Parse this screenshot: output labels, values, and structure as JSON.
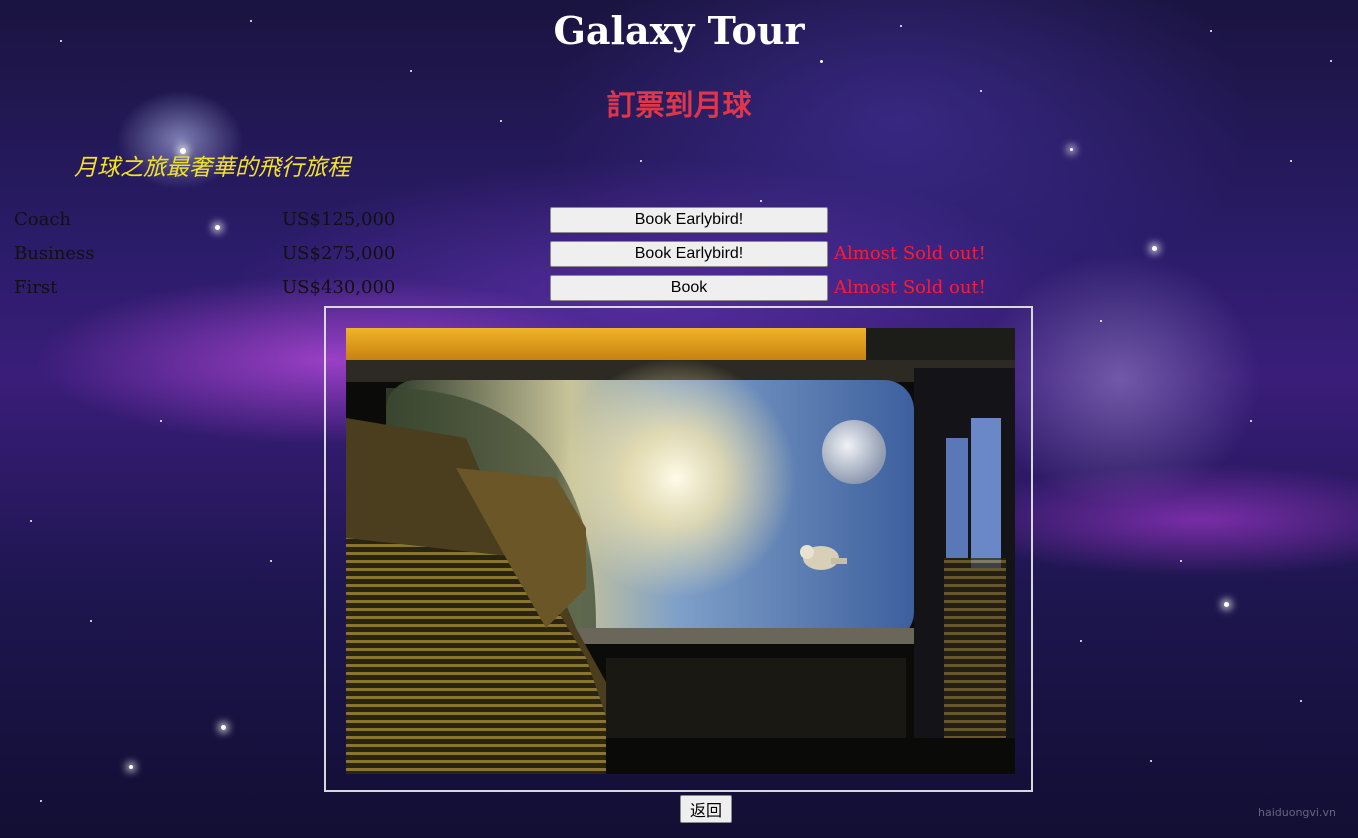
{
  "page": {
    "title": "Galaxy Tour",
    "subtitle": "訂票到月球",
    "tagline": "月球之旅最奢華的飛行旅程"
  },
  "fares": [
    {
      "class": "Coach",
      "price": "US$125,000",
      "button": "Book Earlybird!",
      "status": ""
    },
    {
      "class": "Business",
      "price": "US$275,000",
      "button": "Book Earlybird!",
      "status": "Almost Sold out!"
    },
    {
      "class": "First",
      "price": "US$430,000",
      "button": "Book",
      "status": "Almost Sold out!"
    }
  ],
  "back_button": "返回",
  "watermark": "haiduongvi.vn",
  "colors": {
    "title": "#ffffff",
    "subtitle": "#e0354a",
    "tagline": "#f2e22a",
    "status": "#ff1a2e"
  }
}
